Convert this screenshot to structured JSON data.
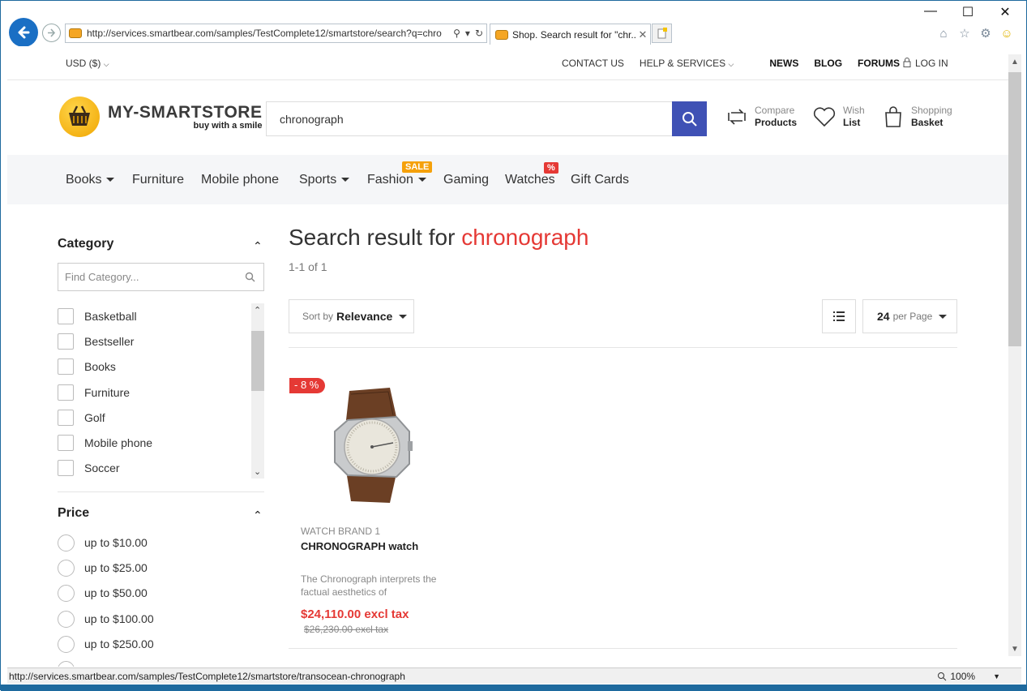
{
  "browser": {
    "url": "http://services.smartbear.com/samples/TestComplete12/smartstore/search?q=chro",
    "tab_title": "Shop. Search result for \"chr...",
    "tab_close": "✕",
    "status_url": "http://services.smartbear.com/samples/TestComplete12/smartstore/transocean-chronograph",
    "zoom": "100%"
  },
  "topbar": {
    "currency": "USD ($)",
    "links": [
      "CONTACT US",
      "HELP & SERVICES"
    ],
    "bold_links": [
      "NEWS",
      "BLOG",
      "FORUMS"
    ],
    "login": "LOG IN"
  },
  "header": {
    "logo_main": "MY-SMARTSTORE",
    "logo_sub": "buy with a smile",
    "search_value": "chronograph",
    "compare_small": "Compare",
    "compare_bold": "Products",
    "wish_small": "Wish",
    "wish_bold": "List",
    "basket_small": "Shopping",
    "basket_bold": "Basket"
  },
  "nav": {
    "items": [
      "Books",
      "Furniture",
      "Mobile phone",
      "Sports",
      "Fashion",
      "Gaming",
      "Watches",
      "Gift Cards"
    ],
    "sale_badge": "SALE",
    "percent_badge": "%"
  },
  "sidebar": {
    "category_title": "Category",
    "category_placeholder": "Find Category...",
    "categories": [
      "Basketball",
      "Bestseller",
      "Books",
      "Furniture",
      "Golf",
      "Mobile phone",
      "Soccer"
    ],
    "price_title": "Price",
    "prices": [
      "up to $10.00",
      "up to $25.00",
      "up to $50.00",
      "up to $100.00",
      "up to $250.00"
    ]
  },
  "main": {
    "title_prefix": "Search result for",
    "query": "chronograph",
    "count": "1-1 of 1",
    "sort_label": "Sort by",
    "sort_value": "Relevance",
    "per_page_value": "24",
    "per_page_label": "per Page"
  },
  "product": {
    "discount": "- 8 %",
    "brand": "WATCH BRAND 1",
    "name": "CHRONOGRAPH watch",
    "description": "The Chronograph interprets the factual aesthetics of",
    "price": "$24,110.00 excl tax",
    "old_price": "$26,230.00 excl tax"
  },
  "colors": {
    "accent_blue": "#3f51b5",
    "sale_red": "#e53935",
    "sale_orange": "#f5a10b"
  }
}
